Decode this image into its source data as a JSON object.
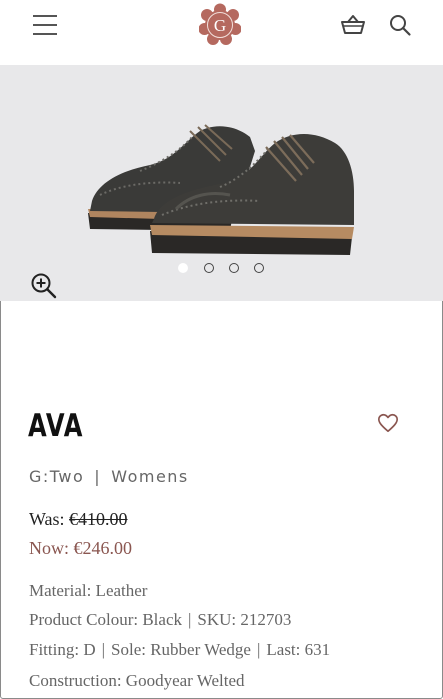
{
  "header": {
    "logo_letter": "G",
    "menu_icon": "hamburger-menu-icon",
    "basket_icon": "basket-icon",
    "search_icon": "search-icon"
  },
  "gallery": {
    "slide_count": 4,
    "active_slide": 1,
    "zoom_icon": "zoom-in-icon"
  },
  "product": {
    "name": "AVA",
    "range": "G:Two",
    "separator": "|",
    "category": "Womens",
    "was_label": "Was:",
    "was_price": "€410.00",
    "now_label": "Now:",
    "now_price": "€246.00",
    "wishlist_icon": "heart-icon"
  },
  "specs": {
    "material": "Material: Leather",
    "colour": "Product Colour: Black",
    "sku": "SKU: 212703",
    "fitting": "Fitting: D",
    "sole": "Sole: Rubber Wedge",
    "last": "Last: 631",
    "construction": "Construction: Goodyear Welted"
  },
  "colors": {
    "sale_price": "#8a5650",
    "logo": "#b5695f",
    "hero_bg": "#e8e8ea"
  }
}
